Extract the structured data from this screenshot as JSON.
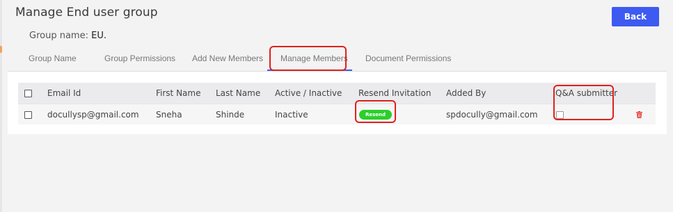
{
  "page": {
    "title": "Manage End user group",
    "back_label": "Back",
    "group_name_label": "Group name:",
    "group_name_value": "EU."
  },
  "tabs": [
    {
      "label": "Group Name"
    },
    {
      "label": "Group Permissions"
    },
    {
      "label": "Add New Members"
    },
    {
      "label": "Manage Members",
      "active": true
    },
    {
      "label": "Document Permissions"
    }
  ],
  "table": {
    "headers": {
      "email": "Email Id",
      "first_name": "First Name",
      "last_name": "Last Name",
      "status": "Active / Inactive",
      "resend": "Resend Invitation",
      "added_by": "Added By",
      "qa": "Q&A submitter"
    },
    "rows": [
      {
        "email": "docullysp@gmail.com",
        "first_name": "Sneha",
        "last_name": "Shinde",
        "status": "Inactive",
        "resend_label": "Resend",
        "added_by": "spdocully@gmail.com",
        "qa_checked": false,
        "delete_icon": "trash-icon"
      }
    ]
  },
  "colors": {
    "accent": "#3d5af1",
    "resend_button": "#2bcf2b",
    "delete_icon": "#e53935",
    "highlight": "#e0201b"
  }
}
